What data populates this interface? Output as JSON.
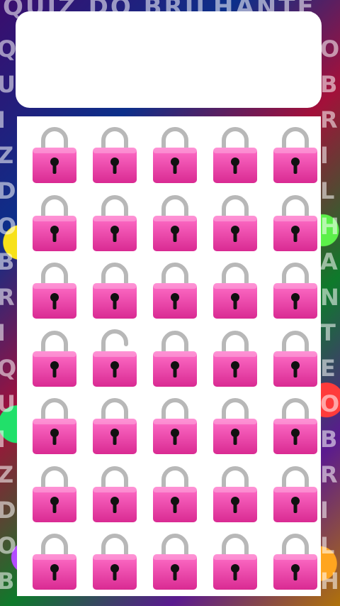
{
  "background": {
    "repeated_text": "QUIZ DO BRILHANTE"
  },
  "title_card": {
    "text": ""
  },
  "puzzle": {
    "item_icon": "padlock-icon",
    "columns": 5,
    "rows": 7,
    "odd_one_out": {
      "row": 3,
      "col": 1,
      "description": "unlocked padlock (open shackle)"
    },
    "colors": {
      "body_top": "#ff6fc8",
      "body_bottom": "#d92a92",
      "shackle": "#b8b8b8",
      "keyhole": "#111111",
      "board": "#ffffff"
    }
  }
}
